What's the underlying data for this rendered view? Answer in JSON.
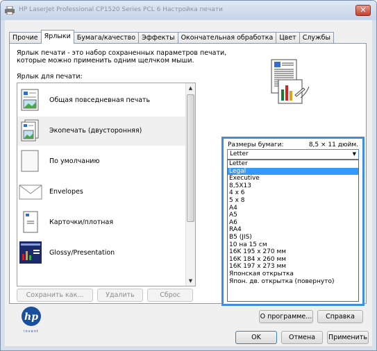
{
  "window": {
    "title": "HP LaserJet Professional CP1520 Series PCL 6 Настройка печати",
    "close_label": "✕"
  },
  "tabs": [
    "Прочие",
    "Ярлыки",
    "Бумага/качество",
    "Эффекты",
    "Окончательная обработка",
    "Цвет",
    "Службы"
  ],
  "active_tab": "Ярлыки",
  "description": "Ярлык печати - это набор сохраненных параметров печати, которые можно применить одним щелчком мыши.",
  "quick_label": "Ярлык для печати:",
  "shortcuts": [
    {
      "label": "Общая повседневная печать",
      "icon": "document-icon",
      "selected": false
    },
    {
      "label": "Экопечать (двусторонняя)",
      "icon": "duplex-document-icon",
      "selected": true
    },
    {
      "label": "По умолчанию",
      "icon": "blank-page-icon",
      "selected": false
    },
    {
      "label": "Envelopes",
      "icon": "envelope-icon",
      "selected": false
    },
    {
      "label": "Карточки/плотная",
      "icon": "card-icon",
      "selected": false
    },
    {
      "label": "Glossy/Presentation",
      "icon": "presentation-icon",
      "selected": false
    }
  ],
  "shortcut_buttons": {
    "save": "Сохранить как...",
    "delete": "Удалить",
    "reset": "Сброс"
  },
  "paper_size": {
    "label": "Размеры бумаги:",
    "value_text": "8,5 × 11 дюйм.",
    "selected": "Letter",
    "highlighted": "Legal",
    "options": [
      "Letter",
      "Legal",
      "Executive",
      "8,5X13",
      "4 x 6",
      "5 x 8",
      "A4",
      "A5",
      "A6",
      "RA4",
      "B5 (JIS)",
      "10 на 15 см",
      "16K 195 x 270 мм",
      "16K 184 x 260 мм",
      "16K 197 x 273 мм",
      "Японская открытка",
      "Япон. дв. открытка (повернуто)"
    ]
  },
  "logo": {
    "brand": "hp",
    "tagline": "invent"
  },
  "buttons": {
    "about": "О программе...",
    "help": "Справка",
    "ok": "OK",
    "cancel": "Отмена",
    "apply": "Применить"
  },
  "colors": {
    "accent": "#3399ff",
    "hp_blue": "#1a4f9c"
  }
}
